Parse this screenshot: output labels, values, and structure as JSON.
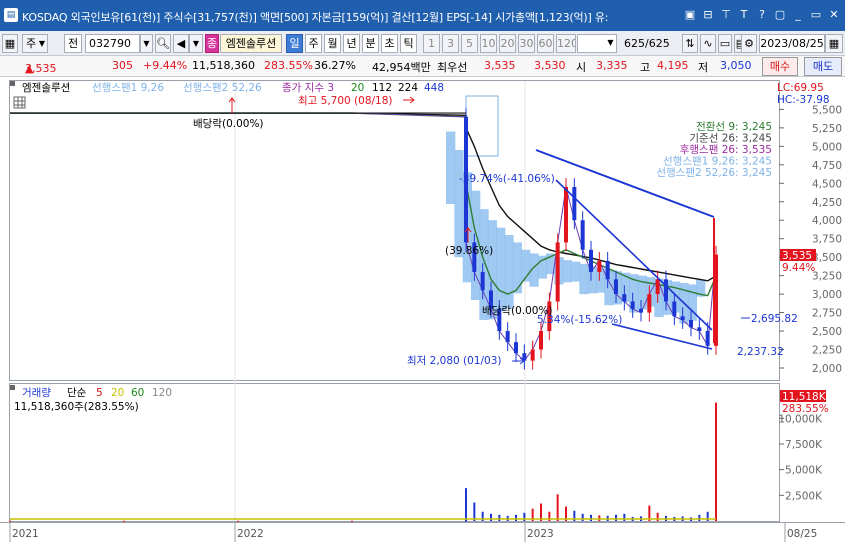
{
  "titlebar": {
    "text": "KOSDAQ 외국인보유[61(천)] 주식수[31,757(천)] 액면[500] 자본금[159(억)] 결산[12월] EPS[-14] 시가총액[1,123(억)] 유:",
    "icons": [
      "window-icon",
      "window-icon",
      "pin-icon",
      "text-icon",
      "help-icon",
      "window-icon",
      "minimize-icon",
      "restore-icon",
      "close-icon"
    ],
    "icon_glyphs": [
      "▣",
      "⊟",
      "⊤",
      "T",
      "?",
      "▢",
      "_",
      "▭",
      "✕"
    ]
  },
  "toolbar": {
    "market_select": "주",
    "market_type": "전",
    "code": "032790",
    "stock_tag": "종",
    "stock_name": "엠젠솔루션",
    "periods": [
      "일",
      "주",
      "월",
      "년",
      "분",
      "초",
      "틱"
    ],
    "active_period": "일",
    "minutes": [
      "1",
      "3",
      "5",
      "10",
      "20",
      "30",
      "60",
      "120"
    ],
    "count": "625",
    "count_total": "/625",
    "date": "2023/08/25"
  },
  "quote": {
    "price": "3,535",
    "arrow": "▲",
    "change": "305",
    "change_pct": "+9.44%",
    "volume": "11,518,360",
    "volume_ratio": "283.55%",
    "turnover_ratio": "36.27%",
    "amount": "42,954백만",
    "ask_label": "최우선",
    "best_ask": "3,535",
    "best_bid": "3,530",
    "open_label": "시",
    "open": "3,335",
    "high_label": "고",
    "high": "4,195",
    "low_label": "저",
    "low": "3,050",
    "buy_label": "매수",
    "sell_label": "매도"
  },
  "chart_header": {
    "stock": "엠젠솔루션",
    "senkou1": "선행스팬1 9,26",
    "senkou2": "선행스팬2 52,26",
    "ma_label": "종가 지수 3",
    "ma_periods": [
      "20",
      "112",
      "224",
      "448"
    ],
    "lc": "LC:69.95",
    "hc": "HC:-37.98"
  },
  "annotations": {
    "high": "최고 5,700 (08/18)",
    "low": "최저 2,080 (01/03)",
    "dividend1": "배당락(0.00%)",
    "dividend2": "배당락(0.00%)",
    "pct_drop": "-39.74%(-41.06%)",
    "pct_rise": "(39.86%)",
    "pct_mid": "5.34%(-15.62%)",
    "trend_upper": "2,695.82",
    "trend_lower": "2,237.32",
    "current_price": "3,535",
    "current_pct": "9.44%"
  },
  "legend": [
    {
      "label": "전환선 9: 3,245",
      "color": "#2e7d32"
    },
    {
      "label": "기준선 26: 3,245",
      "color": "#444444"
    },
    {
      "label": "후행스팬 26: 3,535",
      "color": "#9a2ba0"
    },
    {
      "label": "선행스팬1 9,26: 3,245",
      "color": "#7fb2e6"
    },
    {
      "label": "선행스팬2 52,26: 3,245",
      "color": "#7fb2e6"
    }
  ],
  "volume_header": {
    "label": "거래량",
    "ma_label": "단순",
    "ma_periods": [
      "5",
      "20",
      "60",
      "120"
    ],
    "ma_colors": [
      "#d21515",
      "#c6c000",
      "#1b8a1b",
      "#888888"
    ],
    "current": "11,518,360주(283.55%)",
    "current_tag": "11,518K",
    "current_tag_pct": "283.55%"
  },
  "chart_data": {
    "type": "candlestick",
    "price_axis": [
      "5,500",
      "5,250",
      "5,000",
      "4,750",
      "4,500",
      "4,250",
      "4,000",
      "3,750",
      "3,500",
      "3,250",
      "3,000",
      "2,750",
      "2,500",
      "2,250",
      "2,000"
    ],
    "price_range": [
      2000,
      5600
    ],
    "volume_axis": [
      "10,000K",
      "7,500K",
      "5,000K",
      "2,500K"
    ],
    "volume_range": [
      0,
      11000
    ],
    "x_labels": [
      "2021",
      "2022",
      "2023",
      "08/25"
    ],
    "close": [
      5450,
      5450,
      5450,
      5450,
      5400,
      3700,
      3300,
      3050,
      2800,
      2500,
      2350,
      2200,
      2100,
      2250,
      2500,
      2900,
      3700,
      4450,
      4000,
      3600,
      3300,
      3450,
      3200,
      3000,
      2900,
      2800,
      2750,
      3000,
      3200,
      2900,
      2700,
      2650,
      2550,
      2500,
      2300,
      3535
    ],
    "kijun": [
      5450,
      5450,
      5450,
      5450,
      5420,
      5250,
      5000,
      4700,
      4450,
      4200,
      4050,
      3950,
      3850,
      3750,
      3650,
      3600,
      3570,
      3550,
      3530,
      3510,
      3490,
      3460,
      3430,
      3400,
      3380,
      3360,
      3340,
      3320,
      3300,
      3280,
      3260,
      3240,
      3220,
      3200,
      3180,
      3245
    ],
    "tenkan": [
      5450,
      5450,
      5450,
      5450,
      5400,
      4500,
      3900,
      3500,
      3200,
      3050,
      3000,
      3050,
      3200,
      3350,
      3450,
      3500,
      3550,
      3600,
      3550,
      3500,
      3450,
      3400,
      3350,
      3300,
      3250,
      3200,
      3170,
      3150,
      3130,
      3110,
      3090,
      3060,
      3030,
      3000,
      2980,
      3245
    ],
    "volume": [
      20,
      20,
      20,
      25,
      30,
      3200,
      1800,
      900,
      700,
      600,
      500,
      600,
      800,
      1200,
      1700,
      900,
      2600,
      1400,
      1000,
      700,
      600,
      550,
      500,
      600,
      700,
      400,
      450,
      1500,
      800,
      500,
      400,
      450,
      350,
      600,
      900,
      11518
    ]
  }
}
